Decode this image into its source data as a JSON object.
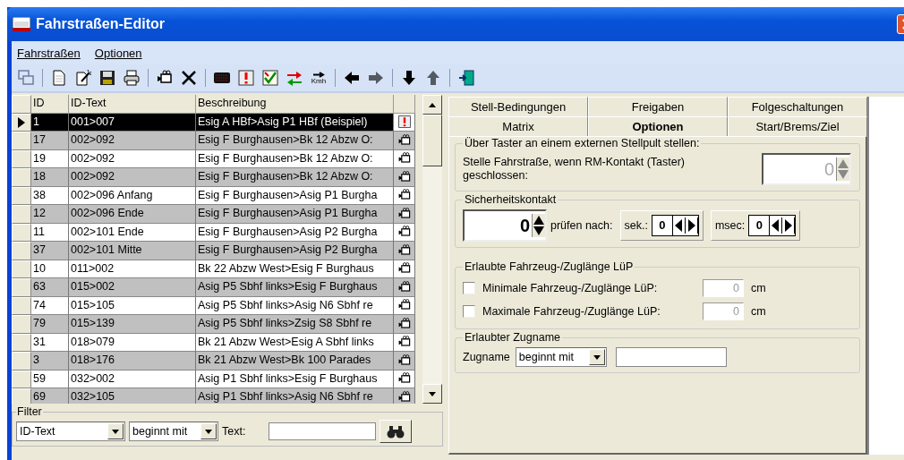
{
  "window": {
    "title": "Fahrstraßen-Editor"
  },
  "menu": [
    {
      "label": "Fahrstraßen"
    },
    {
      "label": "Optionen"
    }
  ],
  "toolbar": [
    {
      "kind": "windows",
      "disabled": true
    },
    {
      "kind": "sep"
    },
    {
      "kind": "new"
    },
    {
      "kind": "wand"
    },
    {
      "kind": "save"
    },
    {
      "kind": "print"
    },
    {
      "kind": "sep"
    },
    {
      "kind": "camera"
    },
    {
      "kind": "delete"
    },
    {
      "kind": "sep"
    },
    {
      "kind": "display"
    },
    {
      "kind": "warning"
    },
    {
      "kind": "check"
    },
    {
      "kind": "swap"
    },
    {
      "kind": "speed",
      "label": "Kmh"
    },
    {
      "kind": "sep"
    },
    {
      "kind": "left"
    },
    {
      "kind": "right",
      "disabled": true
    },
    {
      "kind": "sep"
    },
    {
      "kind": "down"
    },
    {
      "kind": "up",
      "disabled": true
    },
    {
      "kind": "sep"
    },
    {
      "kind": "exit"
    }
  ],
  "table": {
    "columns": [
      "ID",
      "ID-Text",
      "Beschreibung"
    ],
    "rows": [
      {
        "id": "1",
        "id_text": "001>007",
        "description": "Esig A HBf>Asig P1 HBf (Beispiel)",
        "kind": "warning",
        "selected": true
      },
      {
        "id": "17",
        "id_text": "002>092",
        "description": "Esig F Burghausen>Bk 12  Abzw O:",
        "kind": "camera",
        "selected": false
      },
      {
        "id": "19",
        "id_text": "002>092",
        "description": "Esig F Burghausen>Bk 12  Abzw O:",
        "kind": "camera",
        "selected": false
      },
      {
        "id": "18",
        "id_text": "002>092",
        "description": "Esig F Burghausen>Bk 12  Abzw O:",
        "kind": "camera",
        "selected": false
      },
      {
        "id": "38",
        "id_text": "002>096 Anfang",
        "description": "Esig F Burghausen>Asig P1 Burgha",
        "kind": "camera",
        "selected": false
      },
      {
        "id": "12",
        "id_text": "002>096 Ende",
        "description": "Esig F Burghausen>Asig P1 Burgha",
        "kind": "camera",
        "selected": false
      },
      {
        "id": "11",
        "id_text": "002>101 Ende",
        "description": "Esig F Burghausen>Asig P2 Burgha",
        "kind": "camera",
        "selected": false
      },
      {
        "id": "37",
        "id_text": "002>101 Mitte",
        "description": "Esig F Burghausen>Asig P2 Burgha",
        "kind": "camera",
        "selected": false
      },
      {
        "id": "10",
        "id_text": "011>002",
        "description": "Bk 22 Abzw West>Esig F Burghaus",
        "kind": "camera",
        "selected": false
      },
      {
        "id": "63",
        "id_text": "015>002",
        "description": "Asig P5 Sbhf links>Esig F Burghaus",
        "kind": "camera",
        "selected": false
      },
      {
        "id": "74",
        "id_text": "015>105",
        "description": "Asig P5 Sbhf links>Asig N6 Sbhf re",
        "kind": "camera",
        "selected": false
      },
      {
        "id": "79",
        "id_text": "015>139",
        "description": "Asig P5 Sbhf links>Zsig S8 Sbhf re",
        "kind": "camera",
        "selected": false
      },
      {
        "id": "31",
        "id_text": "018>079",
        "description": "Bk 21 Abzw West>Esig A Sbhf links",
        "kind": "camera",
        "selected": false
      },
      {
        "id": "3",
        "id_text": "018>176",
        "description": "Bk 21 Abzw West>Bk 100 Parades",
        "kind": "camera",
        "selected": false
      },
      {
        "id": "59",
        "id_text": "032>002",
        "description": "Asig P1 Sbhf links>Esig F Burghaus",
        "kind": "camera",
        "selected": false
      },
      {
        "id": "69",
        "id_text": "032>105",
        "description": "Asig P1 Sbhf links>Asig N6 Sbhf re",
        "kind": "camera",
        "selected": false
      }
    ]
  },
  "filter": {
    "legend": "Filter",
    "field": "ID-Text",
    "mode": "beginnt mit",
    "text_label": "Text:"
  },
  "tabs": [
    [
      {
        "label": "Stell-Bedingungen",
        "selected": false
      },
      {
        "label": "Freigaben",
        "selected": false
      },
      {
        "label": "Folgeschaltungen",
        "selected": false
      }
    ],
    [
      {
        "label": "Matrix",
        "selected": false
      },
      {
        "label": "Optionen",
        "selected": true
      },
      {
        "label": "Start/Brems/Ziel",
        "selected": false
      }
    ]
  ],
  "taster": {
    "legend": "Über Taster an einem externen Stellpult stellen:",
    "label": "Stelle Fahrstraße, wenn RM-Kontakt (Taster) geschlossen:",
    "value": "0",
    "disabled": true
  },
  "sicherheit": {
    "legend": "Sicherheitskontakt",
    "value": "0",
    "check_label": "prüfen nach:",
    "sek_label": "sek.:",
    "sek_value": "0",
    "msec_label": "msec:",
    "msec_value": "0"
  },
  "laenge": {
    "legend": "Erlaubte Fahrzeug-/Zuglänge LüP",
    "items": [
      {
        "label": "Minimale Fahrzeug-/Zuglänge LüP:",
        "checked": false,
        "value": "0",
        "unit": "cm"
      },
      {
        "label": "Maximale Fahrzeug-/Zuglänge LüP:",
        "checked": false,
        "value": "0",
        "unit": "cm"
      }
    ]
  },
  "zugname": {
    "legend": "Erlaubter Zugname",
    "label": "Zugname",
    "mode": "beginnt mit"
  }
}
